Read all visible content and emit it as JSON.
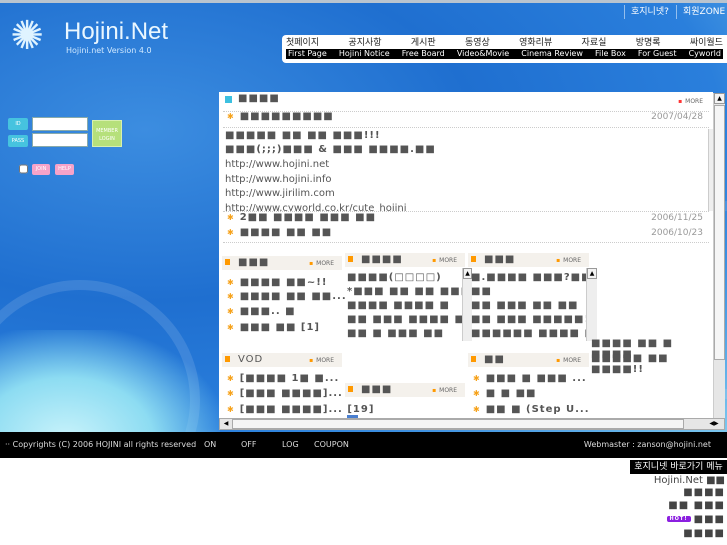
{
  "top_links": [
    "호지니넷?",
    "회원ZONE"
  ],
  "logo": {
    "title": "Hojini.Net",
    "version": "Hojini.net Version 4.0"
  },
  "nav": [
    {
      "ko": "첫페이지",
      "en": "First Page"
    },
    {
      "ko": "공지사항",
      "en": "Hojini Notice"
    },
    {
      "ko": "게시판",
      "en": "Free Board"
    },
    {
      "ko": "동영상",
      "en": "Video&Movie"
    },
    {
      "ko": "영화리뷰",
      "en": "Cinema Review"
    },
    {
      "ko": "자료실",
      "en": "File Box"
    },
    {
      "ko": "방명록",
      "en": "For Guest"
    },
    {
      "ko": "싸이월드",
      "en": "Cyworld"
    }
  ],
  "login": {
    "id_label": "ID",
    "pass_label": "PASS",
    "button": "MEMBER LOGIN",
    "join": "JOIN",
    "help": "HELP"
  },
  "notice": {
    "title": "■■■■",
    "more": "MORE",
    "top_item": {
      "title": "■■■■■■■■■",
      "date": "2007/04/28"
    },
    "body_lines": [
      "■■■■■ ■■ ■■ ■■■!!!",
      "■■■(;;;)■■■ & ■■■ ■■■■.■■",
      "http://www.hojini.net",
      "http://www.hojini.info",
      "http://www.jirilim.com",
      "http://www.cyworld.co.kr/cute_hojini"
    ],
    "items": [
      {
        "title": "2■■ ■■■■ ■■■ ■■",
        "date": "2006/11/25"
      },
      {
        "title": "■■■■ ■■ ■■",
        "date": "2006/10/23"
      }
    ]
  },
  "box1": {
    "title": "■■■",
    "more": "MORE",
    "items": [
      "■■■■ ■■~!!",
      "■■■■ ■■ ■■...",
      "■■■.. ■",
      "■■■ ■■ [1]"
    ]
  },
  "box2": {
    "title": "■■■■",
    "more": "MORE",
    "lines": [
      "■■■■(□□□□)",
      "*■■■ ■■ ■■ ■■■",
      "■■■■ ■■■■ ■",
      "■■  ■■■ ■■■■ ■",
      "■■ ■ ■■■ ■■"
    ]
  },
  "box3": {
    "title": "■■■",
    "more": "MORE",
    "lines": [
      "■.■■■■ ■■■?■■",
      "■■",
      "■■ ■■■ ■■ ■■",
      "■■ ■■■ ■■■■■!",
      "■■■■■■ ■■■■ ■"
    ],
    "overflow": [
      "■■■■ ■■ ■ ■■■■",
      "■■■■■ ■■ ■■■■!!"
    ]
  },
  "vod": {
    "title": "VOD",
    "more": "MORE",
    "items": [
      "[■■■■ 1■ ■...",
      "[■■■ ■■■■]...",
      "[■■■ ■■■■]... [19]"
    ]
  },
  "box5": {
    "title": "■■■",
    "more": "MORE"
  },
  "box6": {
    "title": "■■",
    "more": "MORE",
    "items": [
      "■■■ ■ ■■■ ...",
      "■ ■ ■■",
      "■■ ■ (Step U..."
    ]
  },
  "footer": {
    "copyright": "·· Copyrights (C) 2006 HOJINI all rights reserved",
    "links": [
      "ON",
      "OFF",
      "LOG",
      "COUPON"
    ],
    "webmaster": "Webmaster : zanson@hojini.net"
  },
  "quick": {
    "title": "호지니넷 바로가기 메뉴",
    "items": [
      "Hojini.Net ■■",
      "■■■■",
      "■■ ■■■",
      "■■■",
      "■■■■"
    ],
    "hot": "HOT!"
  }
}
